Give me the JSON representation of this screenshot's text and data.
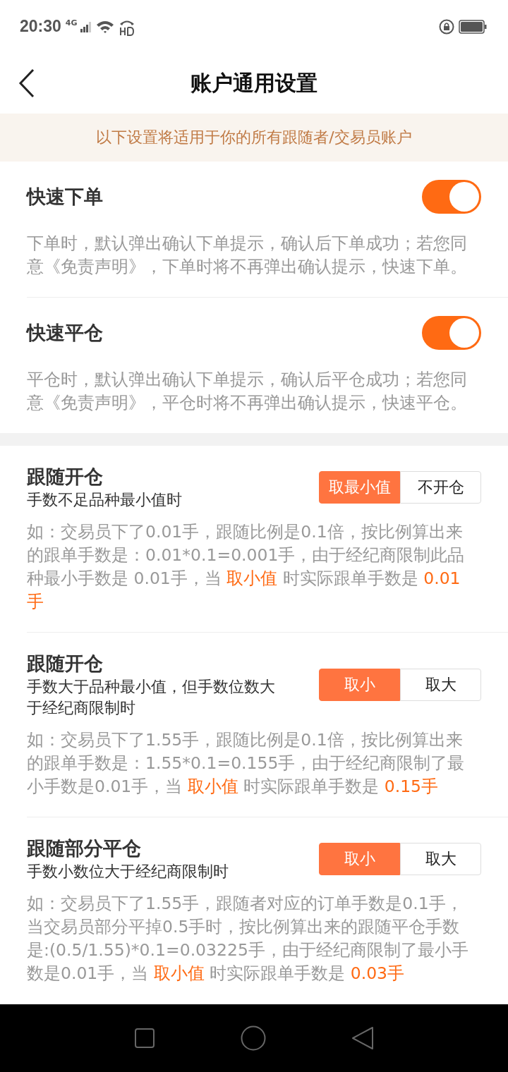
{
  "status_bar": {
    "time": "20:30",
    "network": "4G"
  },
  "header": {
    "title": "账户通用设置"
  },
  "notice": "以下设置将适用于你的所有跟随者/交易员账户",
  "groups": [
    {
      "settings": [
        {
          "kind": "toggle",
          "title": "快速下单",
          "on": true,
          "description": [
            {
              "text": "下单时，默认弹出确认下单提示，确认后下单成功；若您同意《免责声明》，下单时将不再弹出确认提示，快速下单。",
              "highlight": false
            }
          ]
        },
        {
          "kind": "toggle",
          "title": "快速平仓",
          "on": true,
          "description": [
            {
              "text": "平仓时，默认弹出确认下单提示，确认后平仓成功；若您同意《免责声明》，平仓时将不再弹出确认提示，快速平仓。",
              "highlight": false
            }
          ]
        }
      ]
    },
    {
      "settings": [
        {
          "kind": "segmented",
          "title": "跟随开仓",
          "subtitle": "手数不足品种最小值时",
          "options": [
            {
              "label": "取最小值",
              "selected": true
            },
            {
              "label": "不开仓",
              "selected": false
            }
          ],
          "description": [
            {
              "text": "如：交易员下了0.01手，跟随比例是0.1倍，按比例算出来的跟单手数是：0.01*0.1=0.001手，由于经纪商限制此品种最小手数是 0.01手，当 ",
              "highlight": false
            },
            {
              "text": "取小值",
              "highlight": true
            },
            {
              "text": " 时实际跟单手数是 ",
              "highlight": false
            },
            {
              "text": "0.01手",
              "highlight": true
            }
          ]
        },
        {
          "kind": "segmented",
          "title": "跟随开仓",
          "subtitle": "手数大于品种最小值，但手数位数大于经纪商限制时",
          "options": [
            {
              "label": "取小",
              "selected": true
            },
            {
              "label": "取大",
              "selected": false
            }
          ],
          "description": [
            {
              "text": "如：交易员下了1.55手，跟随比例是0.1倍，按比例算出来的跟单手数是：1.55*0.1=0.155手，由于经纪商限制了最小手数是0.01手，当 ",
              "highlight": false
            },
            {
              "text": "取小值",
              "highlight": true
            },
            {
              "text": " 时实际跟单手数是 ",
              "highlight": false
            },
            {
              "text": "0.15手",
              "highlight": true
            }
          ]
        },
        {
          "kind": "segmented",
          "title": "跟随部分平仓",
          "subtitle": "手数小数位大于经纪商限制时",
          "options": [
            {
              "label": "取小",
              "selected": true
            },
            {
              "label": "取大",
              "selected": false
            }
          ],
          "description": [
            {
              "text": "如：交易员下了1.55手，跟随者对应的订单手数是0.1手，当交易员部分平掉0.5手时，按比例算出来的跟随平仓手数是:(0.5/1.55)*0.1=0.03225手，由于经纪商限制了最小手数是0.01手，当 ",
              "highlight": false
            },
            {
              "text": "取小值",
              "highlight": true
            },
            {
              "text": " 时实际跟单手数是 ",
              "highlight": false
            },
            {
              "text": "0.03手",
              "highlight": true
            }
          ]
        }
      ]
    }
  ]
}
